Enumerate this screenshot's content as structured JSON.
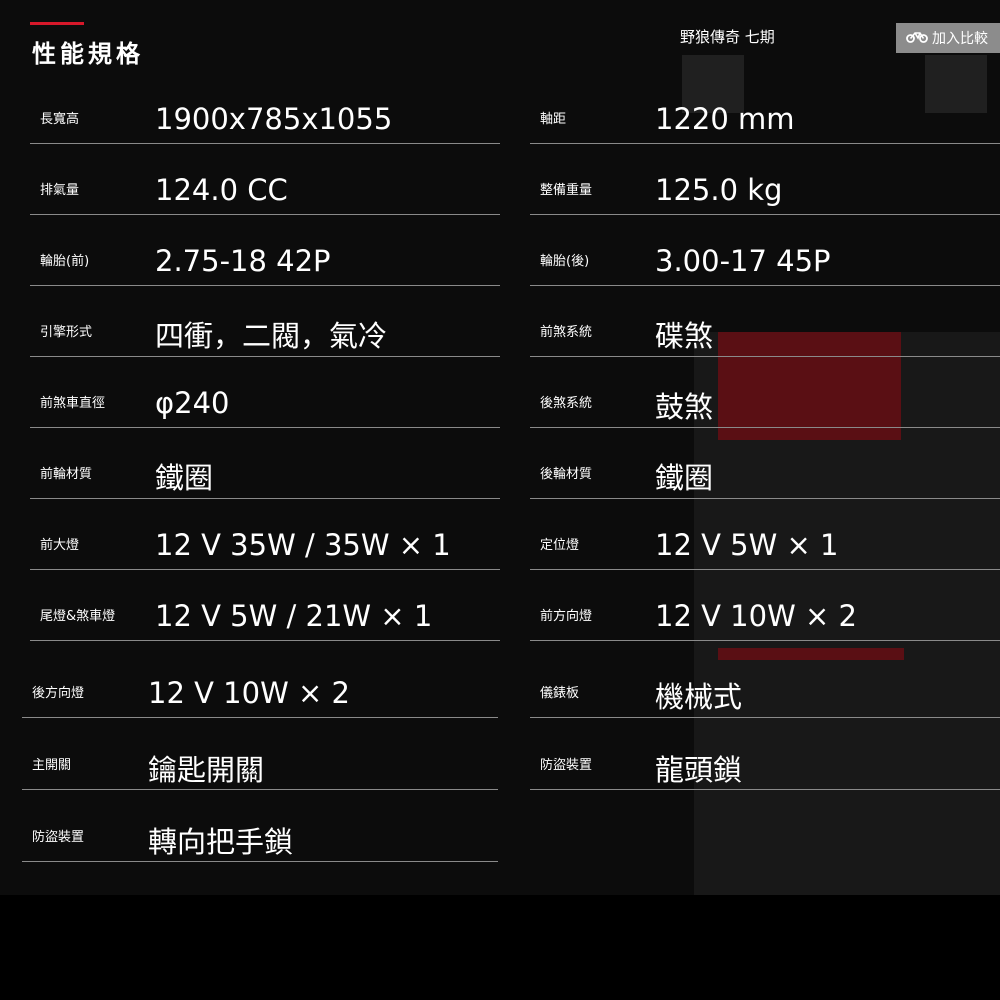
{
  "page_title": "性能規格",
  "model_name": "野狼傳奇 七期",
  "compare_button": {
    "label": "加入比較",
    "icon": "motorcycle-icon"
  },
  "left_specs": [
    {
      "label": "長寬高",
      "value": "1900x785x1055"
    },
    {
      "label": "排氣量",
      "value": "124.0 CC"
    },
    {
      "label": "輪胎(前)",
      "value": "2.75-18 42P"
    },
    {
      "label": "引擎形式",
      "value": "四衝，二閥，氣冷"
    },
    {
      "label": "前煞車直徑",
      "value": "φ240"
    },
    {
      "label": "前輪材質",
      "value": "鐵圈"
    },
    {
      "label": "前大燈",
      "value": "12 V 35W / 35W × 1"
    },
    {
      "label": "尾燈&煞車燈",
      "value": "12 V 5W / 21W × 1"
    },
    {
      "label": "後方向燈",
      "value": "12 V 10W × 2"
    },
    {
      "label": "主開關",
      "value": "鑰匙開關"
    },
    {
      "label": "防盜裝置",
      "value": "轉向把手鎖"
    }
  ],
  "right_specs": [
    {
      "label": "軸距",
      "value": "1220 mm"
    },
    {
      "label": "整備重量",
      "value": "125.0 kg"
    },
    {
      "label": "輪胎(後)",
      "value": "3.00-17 45P"
    },
    {
      "label": "前煞系統",
      "value": "碟煞"
    },
    {
      "label": "後煞系統",
      "value": "鼓煞"
    },
    {
      "label": "後輪材質",
      "value": "鐵圈"
    },
    {
      "label": "定位燈",
      "value": "12 V 5W × 1"
    },
    {
      "label": "前方向燈",
      "value": "12 V 10W × 2"
    },
    {
      "label": "儀錶板",
      "value": "機械式"
    },
    {
      "label": "防盜裝置",
      "value": "龍頭鎖"
    }
  ]
}
